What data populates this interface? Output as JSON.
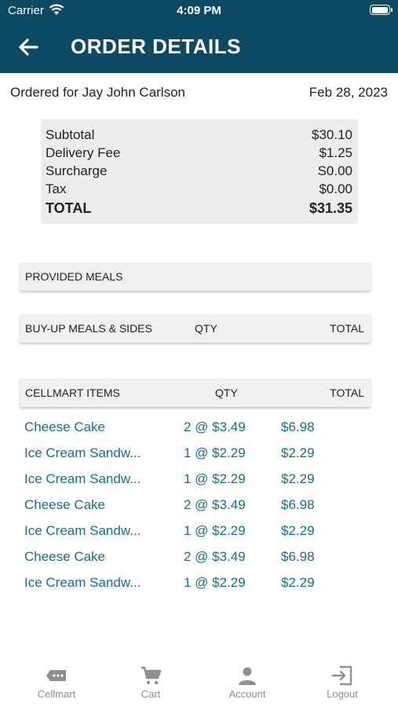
{
  "status": {
    "carrier": "Carrier",
    "time": "4:09 PM"
  },
  "header": {
    "title": "ORDER DETAILS"
  },
  "order": {
    "customer": "Ordered for Jay John Carlson",
    "date": "Feb 28, 2023"
  },
  "summary": [
    {
      "label": "Subtotal",
      "value": "$30.10"
    },
    {
      "label": "Delivery Fee",
      "value": "$1.25"
    },
    {
      "label": "Surcharge",
      "value": "S0.00"
    },
    {
      "label": "Tax",
      "value": "$0.00"
    }
  ],
  "total": {
    "label": "TOTAL",
    "value": "$31.35"
  },
  "sections": {
    "provided": {
      "label": "PROVIDED MEALS"
    },
    "buyup": {
      "label": "BUY-UP MEALS & SIDES",
      "qty": "QTY",
      "total": "TOTAL"
    },
    "cellmart": {
      "label": "CELLMART ITEMS",
      "qty": "QTY",
      "total": "TOTAL"
    }
  },
  "items": [
    {
      "name": "Cheese Cake",
      "qty": "2 @ $3.49",
      "total": "$6.98"
    },
    {
      "name": "Ice Cream Sandw...",
      "qty": "1 @ $2.29",
      "total": "$2.29"
    },
    {
      "name": "Ice Cream Sandw...",
      "qty": "1 @ $2.29",
      "total": "$2.29"
    },
    {
      "name": "Cheese Cake",
      "qty": "2 @ $3.49",
      "total": "$6.98"
    },
    {
      "name": "Ice Cream Sandw...",
      "qty": "1 @ $2.29",
      "total": "$2.29"
    },
    {
      "name": "Cheese Cake",
      "qty": "2 @ $3.49",
      "total": "$6.98"
    },
    {
      "name": "Ice Cream Sandw...",
      "qty": "1 @ $2.29",
      "total": "$2.29"
    }
  ],
  "tabs": [
    {
      "label": "Cellmart",
      "icon": "cellmart-ticket-icon"
    },
    {
      "label": "Cart",
      "icon": "cart-icon"
    },
    {
      "label": "Account",
      "icon": "account-icon"
    },
    {
      "label": "Logout",
      "icon": "logout-icon"
    }
  ],
  "colors": {
    "header": "#0c4a63",
    "item_text": "#13708c",
    "tab_text": "#8f8f8f"
  }
}
